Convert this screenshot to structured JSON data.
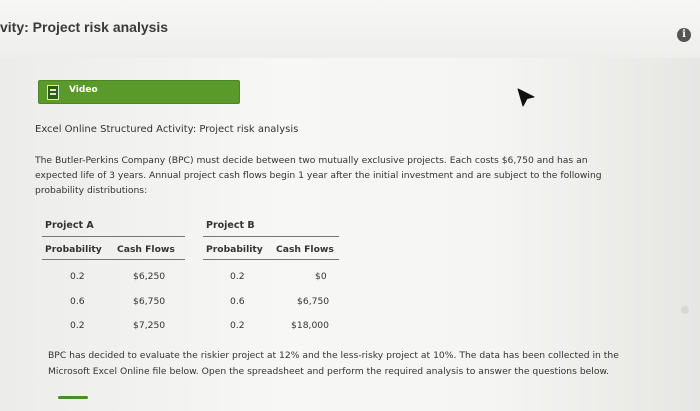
{
  "header": {
    "title": "vity: Project risk analysis",
    "info_icon": "i"
  },
  "video": {
    "label": "Video"
  },
  "activity": {
    "heading": "Excel Online Structured Activity: Project risk analysis"
  },
  "intro": [
    "The Butler-Perkins Company (BPC) must decide between two mutually exclusive projects. Each costs $6,750 and has an",
    "expected life of 3 years. Annual project cash flows begin 1 year after the initial investment and are subject to the following",
    "probability distributions:"
  ],
  "projects": {
    "a": {
      "title": "Project A",
      "headers": [
        "Probability",
        "Cash Flows"
      ],
      "rows": [
        [
          "0.2",
          "$6,250"
        ],
        [
          "0.6",
          "$6,750"
        ],
        [
          "0.2",
          "$7,250"
        ]
      ]
    },
    "b": {
      "title": "Project B",
      "headers": [
        "Probability",
        "Cash Flows"
      ],
      "rows": [
        [
          "0.2",
          "$0"
        ],
        [
          "0.6",
          "$6,750"
        ],
        [
          "0.2",
          "$18,000"
        ]
      ]
    }
  },
  "closing": [
    "BPC has decided to evaluate the riskier project at 12% and the less-risky project at 10%. The data has been collected in the",
    "Microsoft Excel Online file below. Open the spreadsheet and perform the required analysis to answer the questions below."
  ]
}
